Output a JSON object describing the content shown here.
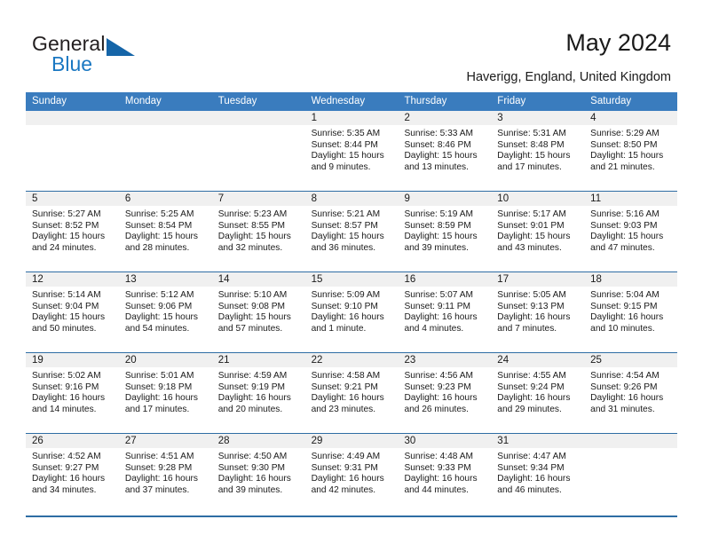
{
  "branding": {
    "logo_primary": "General",
    "logo_secondary": "Blue"
  },
  "header": {
    "title": "May 2024",
    "subtitle": "Haverigg, England, United Kingdom"
  },
  "colors": {
    "header_blue": "#3a7cbe",
    "rule_blue": "#2e6da4",
    "daynum_band": "#f0f0f0",
    "logo_blue": "#1b78c2"
  },
  "labels": {
    "sunrise_prefix": "Sunrise:",
    "sunset_prefix": "Sunset:",
    "daylight_prefix": "Daylight:"
  },
  "calendar": {
    "day_headers": [
      "Sunday",
      "Monday",
      "Tuesday",
      "Wednesday",
      "Thursday",
      "Friday",
      "Saturday"
    ],
    "weeks": [
      [
        {
          "day": "",
          "empty": true,
          "sunrise": "",
          "sunset": "",
          "daylight_line1": "",
          "daylight_line2": ""
        },
        {
          "day": "",
          "empty": true,
          "sunrise": "",
          "sunset": "",
          "daylight_line1": "",
          "daylight_line2": ""
        },
        {
          "day": "",
          "empty": true,
          "sunrise": "",
          "sunset": "",
          "daylight_line1": "",
          "daylight_line2": ""
        },
        {
          "day": "1",
          "sunrise": "Sunrise: 5:35 AM",
          "sunset": "Sunset: 8:44 PM",
          "daylight_line1": "Daylight: 15 hours",
          "daylight_line2": "and 9 minutes."
        },
        {
          "day": "2",
          "sunrise": "Sunrise: 5:33 AM",
          "sunset": "Sunset: 8:46 PM",
          "daylight_line1": "Daylight: 15 hours",
          "daylight_line2": "and 13 minutes."
        },
        {
          "day": "3",
          "sunrise": "Sunrise: 5:31 AM",
          "sunset": "Sunset: 8:48 PM",
          "daylight_line1": "Daylight: 15 hours",
          "daylight_line2": "and 17 minutes."
        },
        {
          "day": "4",
          "sunrise": "Sunrise: 5:29 AM",
          "sunset": "Sunset: 8:50 PM",
          "daylight_line1": "Daylight: 15 hours",
          "daylight_line2": "and 21 minutes."
        }
      ],
      [
        {
          "day": "5",
          "sunrise": "Sunrise: 5:27 AM",
          "sunset": "Sunset: 8:52 PM",
          "daylight_line1": "Daylight: 15 hours",
          "daylight_line2": "and 24 minutes."
        },
        {
          "day": "6",
          "sunrise": "Sunrise: 5:25 AM",
          "sunset": "Sunset: 8:54 PM",
          "daylight_line1": "Daylight: 15 hours",
          "daylight_line2": "and 28 minutes."
        },
        {
          "day": "7",
          "sunrise": "Sunrise: 5:23 AM",
          "sunset": "Sunset: 8:55 PM",
          "daylight_line1": "Daylight: 15 hours",
          "daylight_line2": "and 32 minutes."
        },
        {
          "day": "8",
          "sunrise": "Sunrise: 5:21 AM",
          "sunset": "Sunset: 8:57 PM",
          "daylight_line1": "Daylight: 15 hours",
          "daylight_line2": "and 36 minutes."
        },
        {
          "day": "9",
          "sunrise": "Sunrise: 5:19 AM",
          "sunset": "Sunset: 8:59 PM",
          "daylight_line1": "Daylight: 15 hours",
          "daylight_line2": "and 39 minutes."
        },
        {
          "day": "10",
          "sunrise": "Sunrise: 5:17 AM",
          "sunset": "Sunset: 9:01 PM",
          "daylight_line1": "Daylight: 15 hours",
          "daylight_line2": "and 43 minutes."
        },
        {
          "day": "11",
          "sunrise": "Sunrise: 5:16 AM",
          "sunset": "Sunset: 9:03 PM",
          "daylight_line1": "Daylight: 15 hours",
          "daylight_line2": "and 47 minutes."
        }
      ],
      [
        {
          "day": "12",
          "sunrise": "Sunrise: 5:14 AM",
          "sunset": "Sunset: 9:04 PM",
          "daylight_line1": "Daylight: 15 hours",
          "daylight_line2": "and 50 minutes."
        },
        {
          "day": "13",
          "sunrise": "Sunrise: 5:12 AM",
          "sunset": "Sunset: 9:06 PM",
          "daylight_line1": "Daylight: 15 hours",
          "daylight_line2": "and 54 minutes."
        },
        {
          "day": "14",
          "sunrise": "Sunrise: 5:10 AM",
          "sunset": "Sunset: 9:08 PM",
          "daylight_line1": "Daylight: 15 hours",
          "daylight_line2": "and 57 minutes."
        },
        {
          "day": "15",
          "sunrise": "Sunrise: 5:09 AM",
          "sunset": "Sunset: 9:10 PM",
          "daylight_line1": "Daylight: 16 hours",
          "daylight_line2": "and 1 minute."
        },
        {
          "day": "16",
          "sunrise": "Sunrise: 5:07 AM",
          "sunset": "Sunset: 9:11 PM",
          "daylight_line1": "Daylight: 16 hours",
          "daylight_line2": "and 4 minutes."
        },
        {
          "day": "17",
          "sunrise": "Sunrise: 5:05 AM",
          "sunset": "Sunset: 9:13 PM",
          "daylight_line1": "Daylight: 16 hours",
          "daylight_line2": "and 7 minutes."
        },
        {
          "day": "18",
          "sunrise": "Sunrise: 5:04 AM",
          "sunset": "Sunset: 9:15 PM",
          "daylight_line1": "Daylight: 16 hours",
          "daylight_line2": "and 10 minutes."
        }
      ],
      [
        {
          "day": "19",
          "sunrise": "Sunrise: 5:02 AM",
          "sunset": "Sunset: 9:16 PM",
          "daylight_line1": "Daylight: 16 hours",
          "daylight_line2": "and 14 minutes."
        },
        {
          "day": "20",
          "sunrise": "Sunrise: 5:01 AM",
          "sunset": "Sunset: 9:18 PM",
          "daylight_line1": "Daylight: 16 hours",
          "daylight_line2": "and 17 minutes."
        },
        {
          "day": "21",
          "sunrise": "Sunrise: 4:59 AM",
          "sunset": "Sunset: 9:19 PM",
          "daylight_line1": "Daylight: 16 hours",
          "daylight_line2": "and 20 minutes."
        },
        {
          "day": "22",
          "sunrise": "Sunrise: 4:58 AM",
          "sunset": "Sunset: 9:21 PM",
          "daylight_line1": "Daylight: 16 hours",
          "daylight_line2": "and 23 minutes."
        },
        {
          "day": "23",
          "sunrise": "Sunrise: 4:56 AM",
          "sunset": "Sunset: 9:23 PM",
          "daylight_line1": "Daylight: 16 hours",
          "daylight_line2": "and 26 minutes."
        },
        {
          "day": "24",
          "sunrise": "Sunrise: 4:55 AM",
          "sunset": "Sunset: 9:24 PM",
          "daylight_line1": "Daylight: 16 hours",
          "daylight_line2": "and 29 minutes."
        },
        {
          "day": "25",
          "sunrise": "Sunrise: 4:54 AM",
          "sunset": "Sunset: 9:26 PM",
          "daylight_line1": "Daylight: 16 hours",
          "daylight_line2": "and 31 minutes."
        }
      ],
      [
        {
          "day": "26",
          "sunrise": "Sunrise: 4:52 AM",
          "sunset": "Sunset: 9:27 PM",
          "daylight_line1": "Daylight: 16 hours",
          "daylight_line2": "and 34 minutes."
        },
        {
          "day": "27",
          "sunrise": "Sunrise: 4:51 AM",
          "sunset": "Sunset: 9:28 PM",
          "daylight_line1": "Daylight: 16 hours",
          "daylight_line2": "and 37 minutes."
        },
        {
          "day": "28",
          "sunrise": "Sunrise: 4:50 AM",
          "sunset": "Sunset: 9:30 PM",
          "daylight_line1": "Daylight: 16 hours",
          "daylight_line2": "and 39 minutes."
        },
        {
          "day": "29",
          "sunrise": "Sunrise: 4:49 AM",
          "sunset": "Sunset: 9:31 PM",
          "daylight_line1": "Daylight: 16 hours",
          "daylight_line2": "and 42 minutes."
        },
        {
          "day": "30",
          "sunrise": "Sunrise: 4:48 AM",
          "sunset": "Sunset: 9:33 PM",
          "daylight_line1": "Daylight: 16 hours",
          "daylight_line2": "and 44 minutes."
        },
        {
          "day": "31",
          "sunrise": "Sunrise: 4:47 AM",
          "sunset": "Sunset: 9:34 PM",
          "daylight_line1": "Daylight: 16 hours",
          "daylight_line2": "and 46 minutes."
        },
        {
          "day": "",
          "empty": true,
          "sunrise": "",
          "sunset": "",
          "daylight_line1": "",
          "daylight_line2": ""
        }
      ]
    ]
  }
}
